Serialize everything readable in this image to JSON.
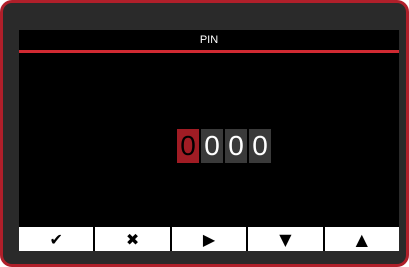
{
  "screen": {
    "title": "PIN"
  },
  "pin": {
    "digits": [
      "0",
      "0",
      "0",
      "0"
    ],
    "active_index": 0
  },
  "softkeys": [
    {
      "name": "confirm-button",
      "icon": "check-icon",
      "glyph": "✔"
    },
    {
      "name": "cancel-button",
      "icon": "close-icon",
      "glyph": "✖"
    },
    {
      "name": "next-button",
      "icon": "play-right-icon",
      "glyph": "▶"
    },
    {
      "name": "down-button",
      "icon": "arrow-down-icon",
      "glyph": "▼"
    },
    {
      "name": "up-button",
      "icon": "arrow-up-icon",
      "glyph": "▲"
    }
  ],
  "colors": {
    "accent": "#d02a32",
    "frame": "#b01f2a",
    "active_digit_bg": "#a01c24",
    "digit_bg": "#3a3a3a",
    "screen_bg": "#000000"
  }
}
